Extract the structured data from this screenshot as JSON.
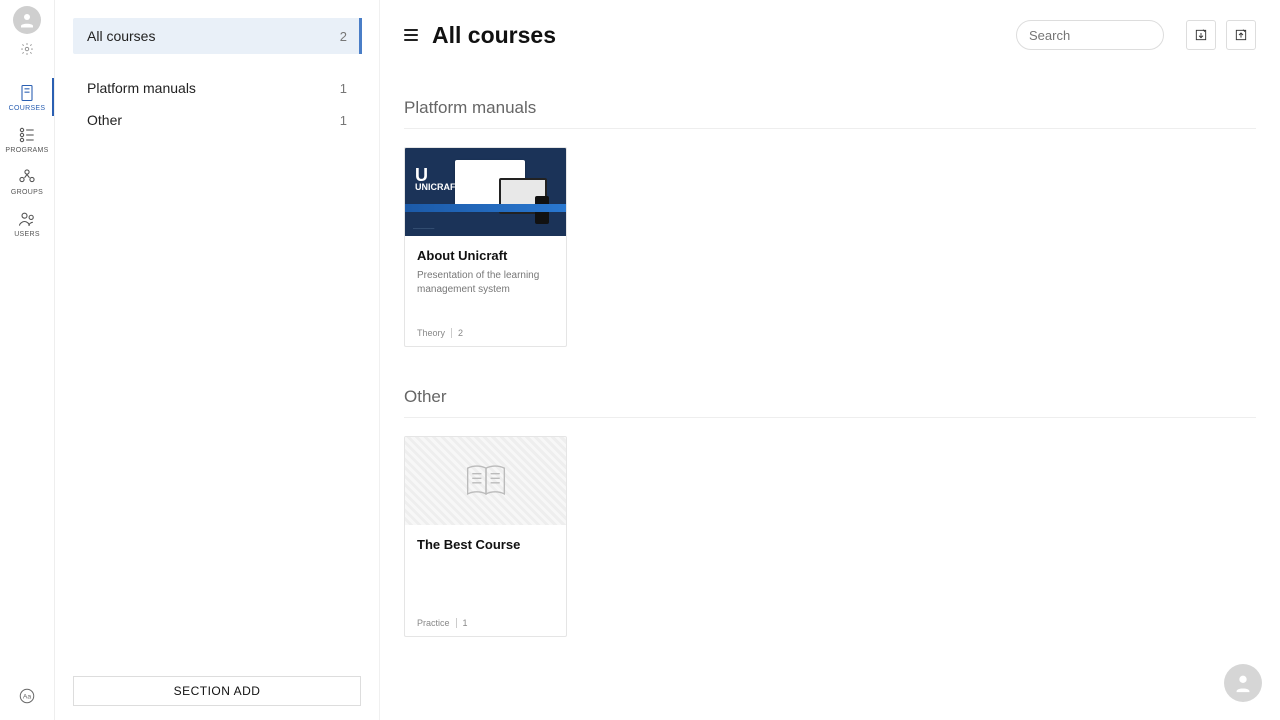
{
  "nav": {
    "courses": "COURSES",
    "programs": "PROGRAMS",
    "groups": "GROUPS",
    "users": "USERS"
  },
  "sidebar": {
    "all": {
      "label": "All courses",
      "count": "2"
    },
    "items": [
      {
        "label": "Platform manuals",
        "count": "1"
      },
      {
        "label": "Other",
        "count": "1"
      }
    ],
    "section_add": "SECTION ADD"
  },
  "header": {
    "title": "All courses",
    "search_placeholder": "Search"
  },
  "sections": [
    {
      "title": "Platform manuals",
      "card": {
        "title": "About Unicraft",
        "desc": "Presentation of the learning management system",
        "meta_label": "Theory",
        "meta_count": "2",
        "logo_brand": "UNICRAFT"
      }
    },
    {
      "title": "Other",
      "card": {
        "title": "The Best Course",
        "desc": "",
        "meta_label": "Practice",
        "meta_count": "1"
      }
    }
  ]
}
